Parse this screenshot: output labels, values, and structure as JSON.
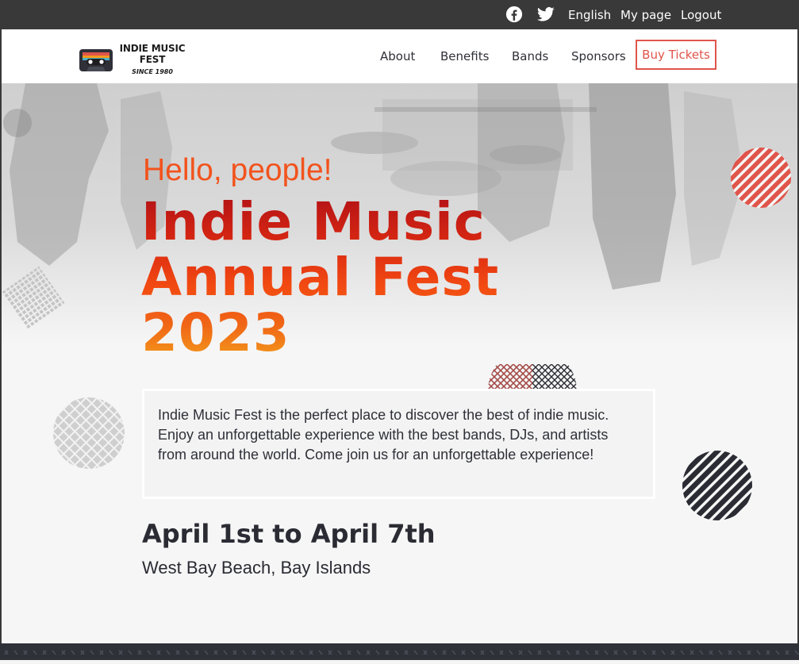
{
  "utility_bar": {
    "facebook_icon": "facebook-icon",
    "twitter_icon": "twitter-icon",
    "language": "English",
    "my_page": "My page",
    "logout": "Logout"
  },
  "navbar": {
    "logo": {
      "title": "INDIE MUSIC FEST",
      "subtitle": "SINCE 1980",
      "icon": "cassette-tape-icon"
    },
    "links": [
      "About",
      "Benefits",
      "Bands",
      "Sponsors"
    ],
    "cta": "Buy Tickets"
  },
  "hero": {
    "greeting": "Hello, people!",
    "headline_line1": "Indie Music",
    "headline_line2": "Annual Fest",
    "headline_line3": "2023",
    "description": "Indie Music Fest is the perfect place to discover the best of indie music. Enjoy an unforgettable experience with the best bands, DJs, and artists from around the world. Come join us for an unforgettable experience!",
    "dates": "April 1st to April 7th",
    "location": "West Bay Beach, Bay Islands"
  },
  "colors": {
    "accent": "#f2531d",
    "cta_border": "#e0554b",
    "utility_bg": "#393939",
    "text_dark": "#2a2b33",
    "deco_red": "#e0554b",
    "deco_dark": "#2a2b33",
    "deco_gray": "#c8c8c8"
  }
}
